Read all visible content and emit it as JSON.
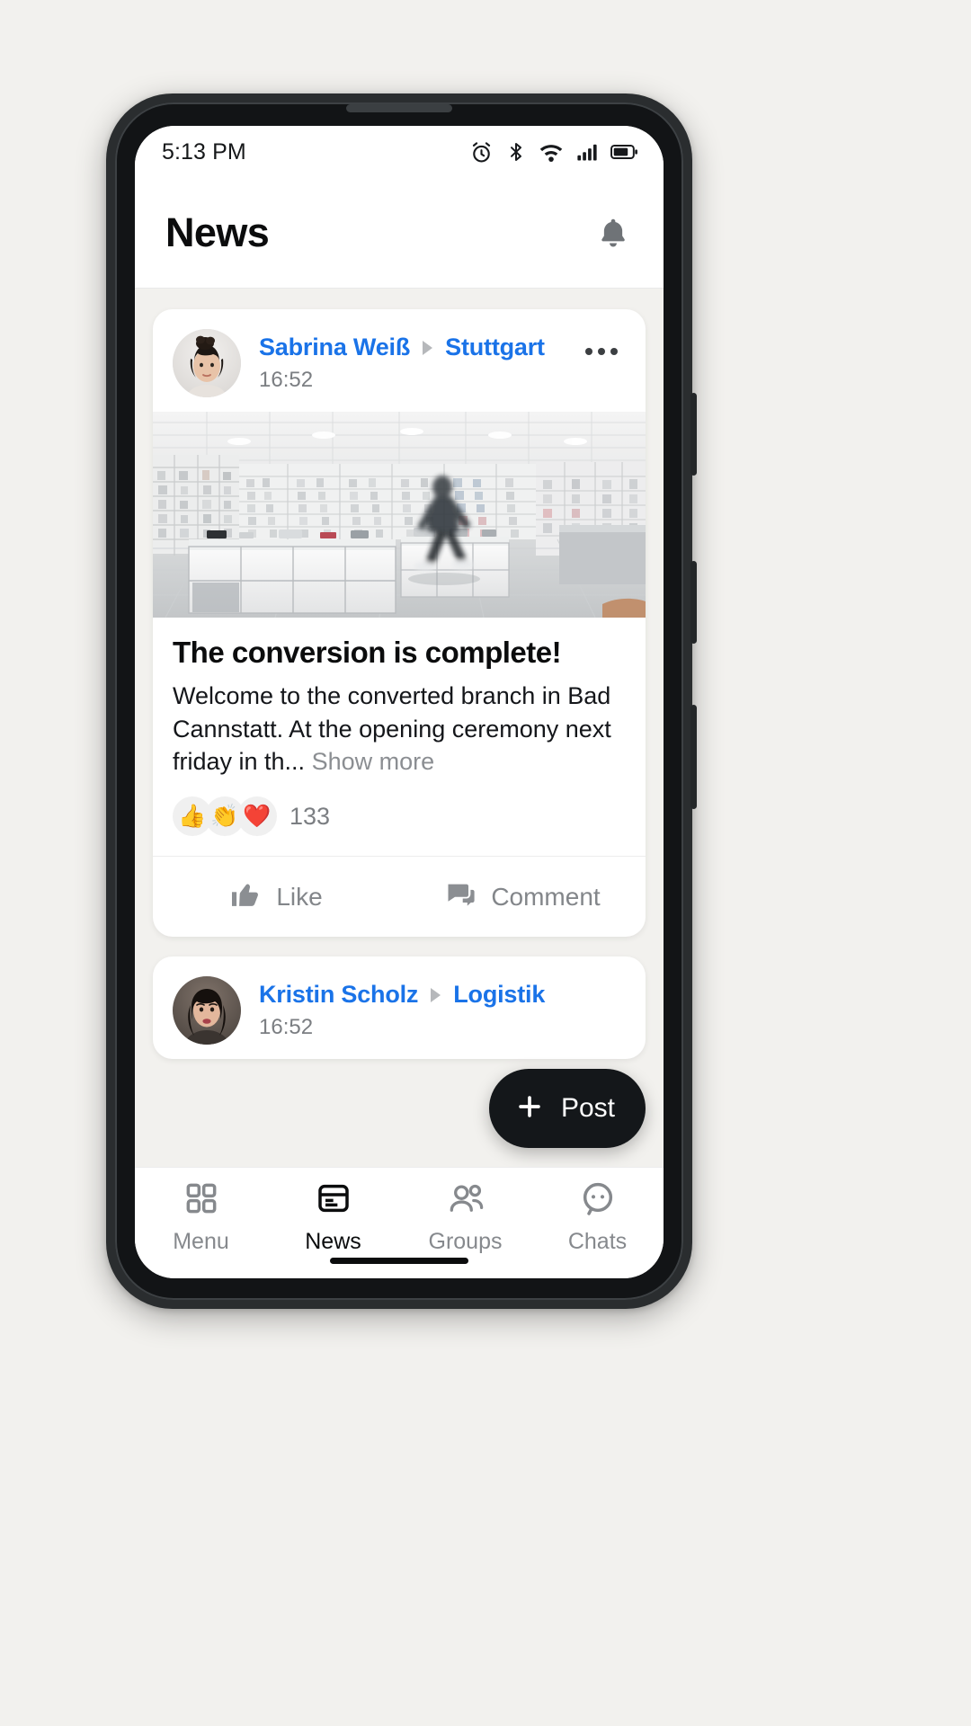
{
  "status_bar": {
    "time": "5:13 PM",
    "icons": [
      "alarm-icon",
      "bluetooth-icon",
      "wifi-icon",
      "cellular-signal-icon",
      "battery-icon"
    ]
  },
  "header": {
    "title": "News",
    "notification_icon": "bell-icon"
  },
  "colors": {
    "link_blue": "#1a73e8",
    "page_background": "#f2f1ee",
    "card_background": "#ffffff",
    "muted_text": "#7b7e82",
    "fab_background": "#14171a"
  },
  "posts": [
    {
      "author": "Sabrina Weiß",
      "separator": "▸",
      "group": "Stuttgart",
      "time": "16:52",
      "more_icon": "more-options-icon",
      "avatar_alt": "woman with dark hair in bun",
      "image_alt": "bright white retail store interior with glass display cubes and a blurred walking person",
      "title": "The conversion is complete!",
      "text": "Welcome to the converted branch in Bad Cannstatt. At the opening ceremony next friday in th...",
      "show_more": "Show more",
      "reactions": [
        "👍",
        "👏",
        "❤️"
      ],
      "reaction_count": "133",
      "actions": [
        {
          "label": "Like",
          "icon": "thumbs-up-icon"
        },
        {
          "label": "Comment",
          "icon": "comment-icon"
        }
      ]
    },
    {
      "author": "Kristin Scholz",
      "separator": "▸",
      "group": "Logistik",
      "time": "16:52",
      "avatar_alt": "woman with dark hair looking at camera"
    }
  ],
  "fab": {
    "label": "Post",
    "icon": "plus-icon"
  },
  "tabs": [
    {
      "label": "Menu",
      "icon": "grid-menu-icon",
      "active": false
    },
    {
      "label": "News",
      "icon": "news-card-icon",
      "active": true
    },
    {
      "label": "Groups",
      "icon": "people-icon",
      "active": false
    },
    {
      "label": "Chats",
      "icon": "chat-bubble-icon",
      "active": false
    }
  ]
}
